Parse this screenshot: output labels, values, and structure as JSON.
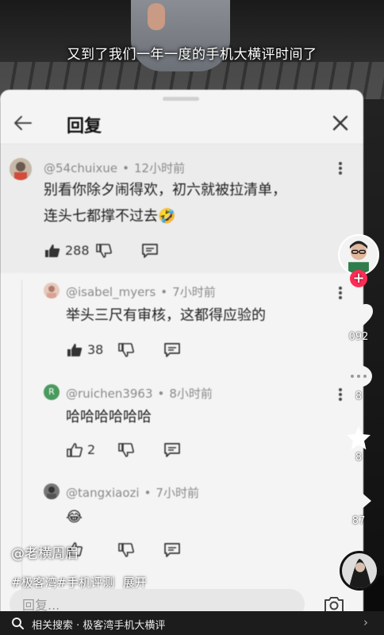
{
  "video": {
    "caption": "又到了我们一年一度的手机大横评时间了"
  },
  "sheet": {
    "title": "回复"
  },
  "comments": [
    {
      "username": "@54chuixue",
      "time": "12小时前",
      "lines": [
        "别看你除夕闹得欢，初六就被拉清单，",
        "连头七都撑不过去🤣"
      ],
      "likes": "288"
    },
    {
      "username": "@isabel_myers",
      "time": "7小时前",
      "lines": [
        "举头三尺有审核，这都得应验的"
      ],
      "likes": "38"
    },
    {
      "username": "@ruichen3963",
      "time": "8小时前",
      "lines": [
        "哈哈哈哈哈哈"
      ],
      "likes": "2"
    },
    {
      "username": "@tangxiaozi",
      "time": "7小时前",
      "lines": [
        "😂"
      ],
      "likes": ""
    }
  ],
  "rail": {
    "like_count": "092",
    "comment_count": "8",
    "favorite_count": "8",
    "share_count": "87"
  },
  "author": "@老横周眉",
  "tags": [
    "#极客湾#手机评测",
    "展开"
  ],
  "reply_input": {
    "placeholder": "回复..."
  },
  "search_bar": {
    "label": "相关搜索 · 极客湾手机大横评",
    "arrow": "›"
  },
  "colors": {
    "follow_red": "#fe2c55",
    "sheet_bg": "#f4f4f4",
    "meta_gray": "#8a8a8a"
  }
}
